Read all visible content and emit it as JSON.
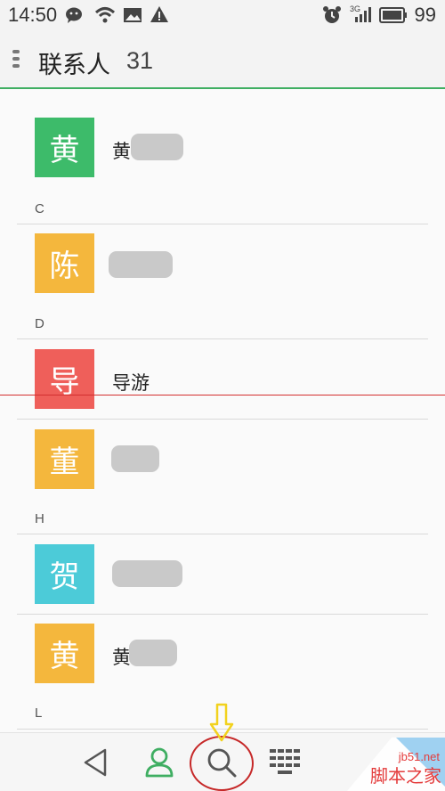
{
  "status_bar": {
    "time": "14:50",
    "network": "3G",
    "battery": "99",
    "icons": [
      "wechat-icon",
      "wifi-icon",
      "image-icon",
      "warning-icon",
      "alarm-icon",
      "signal-icon",
      "battery-icon"
    ]
  },
  "header": {
    "title": "联系人",
    "count": "31"
  },
  "colors": {
    "accent": "#3fae62",
    "avatar_green": "#3dbb6a",
    "avatar_orange": "#f4b73d",
    "avatar_red": "#ef5f5a",
    "avatar_cyan": "#4ccbd8"
  },
  "contacts": [
    {
      "avatar": "黄",
      "name": "黄"
    },
    {
      "section": "C"
    },
    {
      "avatar": "陈",
      "name": ""
    },
    {
      "section": "D"
    },
    {
      "avatar": "导",
      "name": "导游"
    },
    {
      "avatar": "董",
      "name": ""
    },
    {
      "section": "H"
    },
    {
      "avatar": "贺",
      "name": ""
    },
    {
      "avatar": "黄",
      "name": "黄"
    },
    {
      "section": "L"
    }
  ],
  "bottom_nav": {
    "items": [
      "back-icon",
      "contacts-icon",
      "search-icon",
      "dialpad-icon"
    ]
  },
  "watermark": {
    "url": "jb51.net",
    "text": "脚本之家"
  }
}
